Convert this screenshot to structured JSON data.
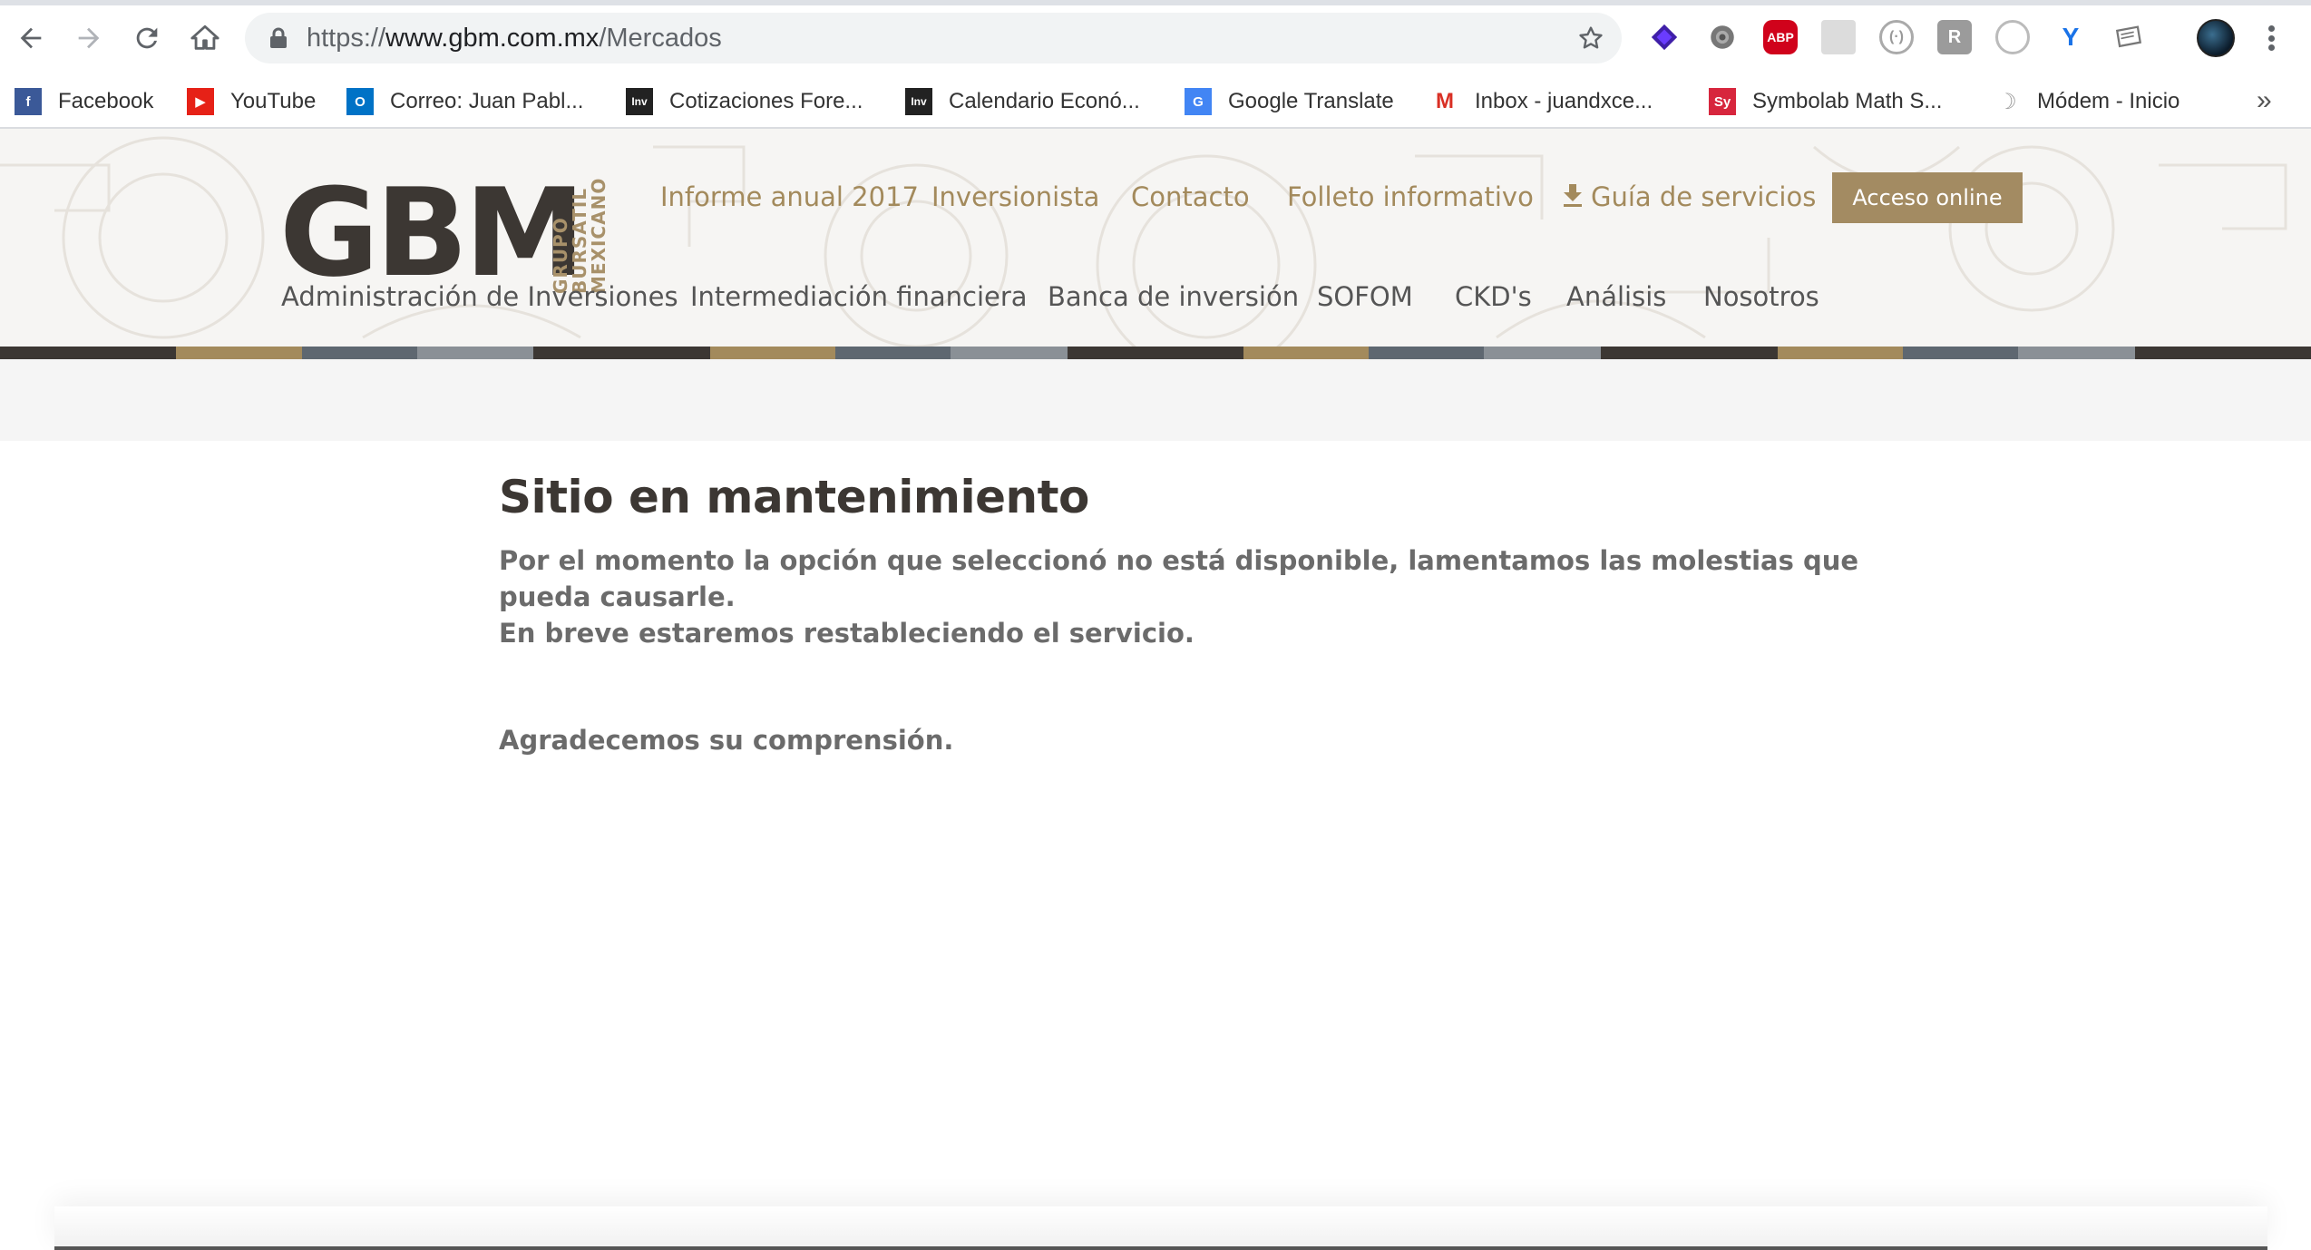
{
  "browser": {
    "url_scheme": "https://",
    "url_host": "www.gbm.com.mx",
    "url_path": "/Mercados",
    "extensions": [
      "layers-icon",
      "gear-icon",
      "abp-icon",
      "grid-icon",
      "brackets-icon",
      "r-icon",
      "target-icon",
      "v-icon",
      "note-icon"
    ],
    "abp_label": "ABP"
  },
  "bookmarks": [
    {
      "label": "Facebook",
      "icon": "facebook-icon",
      "badge": "f",
      "color": "#3b5998"
    },
    {
      "label": "YouTube",
      "icon": "youtube-icon",
      "badge": "▶",
      "color": "#e62117"
    },
    {
      "label": "Correo: Juan Pabl...",
      "icon": "outlook-icon",
      "badge": "O",
      "color": "#0072c6"
    },
    {
      "label": "Cotizaciones Fore...",
      "icon": "investing-icon",
      "badge": "Inv",
      "color": "#222222"
    },
    {
      "label": "Calendario Econó...",
      "icon": "investing-icon",
      "badge": "Inv",
      "color": "#222222"
    },
    {
      "label": "Google Translate",
      "icon": "translate-icon",
      "badge": "G",
      "color": "#4285f4"
    },
    {
      "label": "Inbox - juandxce...",
      "icon": "gmail-icon",
      "badge": "M",
      "color": "#ffffff"
    },
    {
      "label": "Symbolab Math S...",
      "icon": "symbolab-icon",
      "badge": "Sy",
      "color": "#d7263d"
    },
    {
      "label": "Módem - Inicio",
      "icon": "modem-icon",
      "badge": "☽",
      "color": "#ffffff"
    }
  ],
  "bookmarks_more": "»",
  "site": {
    "logo_text": "GBM",
    "logo_tagline": [
      "GRUPO",
      "BURSATIL",
      "MEXICANO"
    ],
    "top_nav": [
      "Informe anual 2017",
      "Inversionista",
      "Contacto",
      "Folleto informativo",
      "Guía de servicios"
    ],
    "acceso_label": "Acceso online",
    "main_nav": [
      "Administración de Inversiones",
      "Intermediación financiera",
      "Banca de inversión",
      "SOFOM",
      "CKD's",
      "Análisis",
      "Nosotros"
    ],
    "colors": {
      "gold": "#a38a5c",
      "dark": "#3c3733",
      "slate": "#5e6770",
      "gray": "#8a9096"
    }
  },
  "content": {
    "title": "Sitio en mantenimiento",
    "message_line1": "Por el momento la opción que seleccionó no está disponible, lamentamos las molestias que pueda causarle.",
    "message_line2": "En breve estaremos restableciendo el servicio.",
    "thanks": "Agradecemos su comprensión."
  }
}
